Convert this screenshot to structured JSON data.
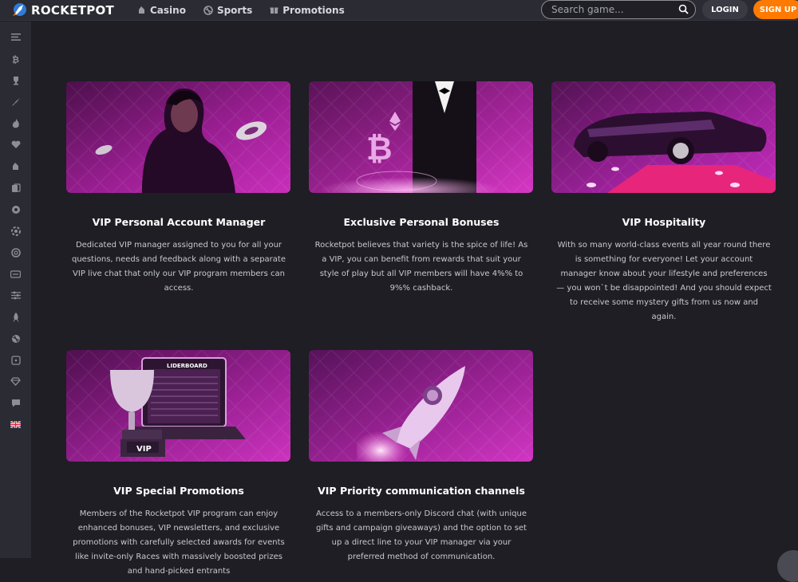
{
  "header": {
    "logo_text": "ROCKETPOT",
    "nav": [
      {
        "label": "Casino",
        "icon": "casino-icon"
      },
      {
        "label": "Sports",
        "icon": "sports-ball-icon"
      },
      {
        "label": "Promotions",
        "icon": "gift-icon"
      }
    ],
    "search_placeholder": "Search game...",
    "login_label": "LOGIN",
    "signup_label": "SIGN UP"
  },
  "sidebar": {
    "items": [
      "menu-icon",
      "bitcoin-icon",
      "trophy-icon",
      "rocket-icon",
      "fire-icon",
      "heart-icon",
      "casino-icon",
      "cards-icon",
      "roulette-icon",
      "poker-chip-icon",
      "coin-icon",
      "ticket-icon",
      "sliders-icon",
      "rocket-small-icon",
      "sports-ball-icon",
      "dice-icon",
      "diamond-icon",
      "chat-icon",
      "uk-flag-icon"
    ]
  },
  "cards": [
    {
      "title": "VIP Personal Account Manager",
      "description": "Dedicated VIP manager assigned to you for all your questions, needs and feedback along with a separate VIP live chat that only our VIP program members can access."
    },
    {
      "title": "Exclusive Personal Bonuses",
      "description": "Rocketpot believes that variety is the spice of life! As a VIP, you can benefit from rewards that suit your style of play but all VIP members will have 4%% to 9%% cashback."
    },
    {
      "title": "VIP Hospitality",
      "description": "With so many world-class events all year round there is something for everyone! Let your account manager know about your lifestyle and preferences — you won`t be disappointed! And you should expect to receive some mystery gifts from us now and again."
    },
    {
      "title": "VIP Special Promotions",
      "description": "Members of the Rocketpot VIP program can enjoy enhanced bonuses, VIP newsletters, and exclusive promotions with carefully selected awards for events like invite-only Races with massively boosted prizes and hand-picked entrants"
    },
    {
      "title": "VIP Priority communication channels",
      "description": "Access to a members-only Discord chat (with unique gifts and campaign giveaways) and the option to set up a direct line to your VIP manager via your preferred method of communication."
    }
  ],
  "image_text": {
    "leaderboard": "LIDERBOARD",
    "vip": "VIP",
    "btc": "₿"
  },
  "colors": {
    "accent": "#ff7a00",
    "background": "#1e1e24",
    "panel": "#2b2b33",
    "card_purple": "#a3239c"
  }
}
